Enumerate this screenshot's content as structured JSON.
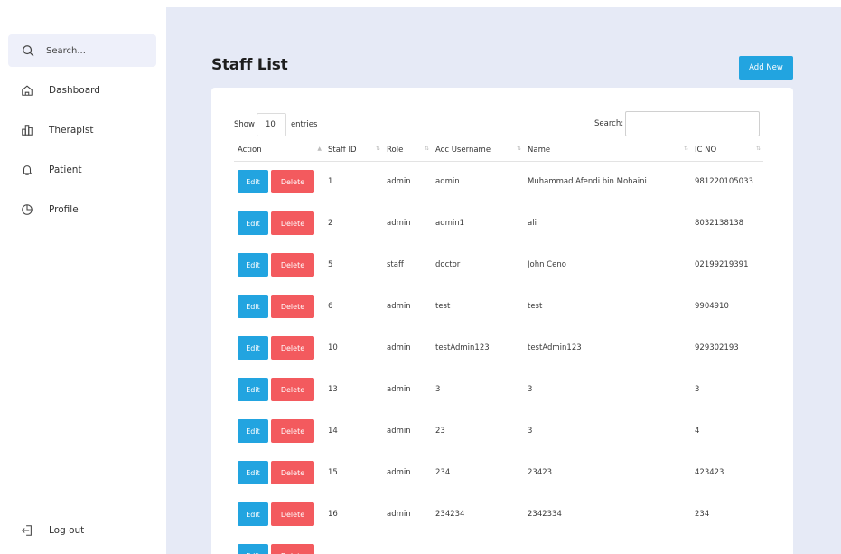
{
  "sidebar": {
    "search_placeholder": "Search...",
    "items": [
      {
        "label": "Dashboard",
        "icon": "home-icon"
      },
      {
        "label": "Therapist",
        "icon": "building-icon"
      },
      {
        "label": "Patient",
        "icon": "bell-icon"
      },
      {
        "label": "Profile",
        "icon": "clock-icon"
      }
    ],
    "logout_label": "Log out"
  },
  "main": {
    "title": "Staff List",
    "add_new_label": "Add New",
    "show_label": "Show",
    "entries_value": "10",
    "entries_label": "entries",
    "search_label": "Search:",
    "columns": [
      "Action",
      "Staff ID",
      "Role",
      "Acc Username",
      "Name",
      "IC NO"
    ],
    "edit_label": "Edit",
    "delete_label": "Delete",
    "rows": [
      {
        "id": "1",
        "role": "admin",
        "username": "admin",
        "name": "Muhammad Afendi bin Mohaini",
        "ic": "981220105033"
      },
      {
        "id": "2",
        "role": "admin",
        "username": "admin1",
        "name": "ali",
        "ic": "8032138138"
      },
      {
        "id": "5",
        "role": "staff",
        "username": "doctor",
        "name": "John Ceno",
        "ic": "02199219391"
      },
      {
        "id": "6",
        "role": "admin",
        "username": "test",
        "name": "test",
        "ic": "9904910"
      },
      {
        "id": "10",
        "role": "admin",
        "username": "testAdmin123",
        "name": "testAdmin123",
        "ic": "929302193"
      },
      {
        "id": "13",
        "role": "admin",
        "username": "3",
        "name": "3",
        "ic": "3"
      },
      {
        "id": "14",
        "role": "admin",
        "username": "23",
        "name": "3",
        "ic": "4"
      },
      {
        "id": "15",
        "role": "admin",
        "username": "234",
        "name": "23423",
        "ic": "423423"
      },
      {
        "id": "16",
        "role": "admin",
        "username": "234234",
        "name": "2342334",
        "ic": "234"
      },
      {
        "id": "",
        "role": "",
        "username": "",
        "name": "",
        "ic": ""
      }
    ]
  },
  "colors": {
    "primary": "#22a4e0",
    "danger": "#f35a5e",
    "background": "#e6eaf6"
  }
}
